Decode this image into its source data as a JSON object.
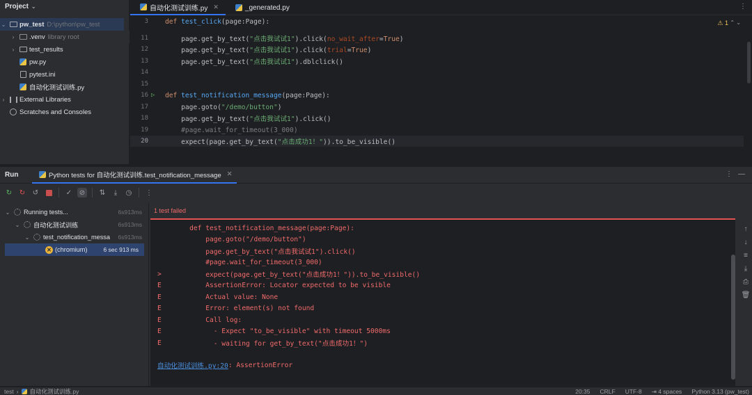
{
  "project": {
    "header": "Project",
    "tree": [
      {
        "label": "pw_test",
        "hint": "D:\\python\\pw_test",
        "type": "root"
      },
      {
        "label": ".venv",
        "hint": "library root",
        "type": "folder-dark"
      },
      {
        "label": "test_results",
        "hint": "",
        "type": "folder"
      },
      {
        "label": "pw.py",
        "hint": "",
        "type": "py"
      },
      {
        "label": "pytest.ini",
        "hint": "",
        "type": "ini"
      },
      {
        "label": "自动化测试训练.py",
        "hint": "",
        "type": "py"
      },
      {
        "label": "External Libraries",
        "hint": "",
        "type": "lib"
      },
      {
        "label": "Scratches and Consoles",
        "hint": "",
        "type": "scratch"
      }
    ]
  },
  "editor": {
    "tabs": [
      {
        "label": "自动化测试训练.py",
        "active": true
      },
      {
        "label": "_generated.py",
        "active": false
      }
    ],
    "warnings": "1",
    "lines": [
      {
        "n": "3",
        "text": "def test_click(page:Page):"
      },
      {
        "n": "11",
        "text": "    page.get_by_text(\"点击我试试1\").click(no_wait_after=True)"
      },
      {
        "n": "12",
        "text": "    page.get_by_text(\"点击我试试1\").click(trial=True)"
      },
      {
        "n": "13",
        "text": "    page.get_by_text(\"点击我试试1\").dblclick()"
      },
      {
        "n": "14",
        "text": ""
      },
      {
        "n": "15",
        "text": ""
      },
      {
        "n": "16",
        "text": "def test_notification_message(page:Page):"
      },
      {
        "n": "17",
        "text": "    page.goto(\"/demo/button\")"
      },
      {
        "n": "18",
        "text": "    page.get_by_text(\"点击我试试1\").click()"
      },
      {
        "n": "19",
        "text": "    #page.wait_for_timeout(3_000)"
      },
      {
        "n": "20",
        "text": "    expect(page.get_by_text(\"点击成功1！\")).to_be_visible()"
      }
    ]
  },
  "run": {
    "title": "Run",
    "tab_label": "Python tests for 自动化测试训练.test_notification_message",
    "tree": [
      {
        "label": "Running tests...",
        "time": "6s913ms"
      },
      {
        "label": "自动化测试训练",
        "time": "6s913ms"
      },
      {
        "label": "test_notification_messa",
        "time": "6s913ms"
      },
      {
        "label": "(chromium)",
        "time": "6 sec 913 ms"
      }
    ],
    "status": "1 test failed",
    "output": [
      {
        "mark": "",
        "text": "    def test_notification_message(page:Page):"
      },
      {
        "mark": "",
        "text": "        page.goto(\"/demo/button\")"
      },
      {
        "mark": "",
        "text": "        page.get_by_text(\"点击我试试1\").click()"
      },
      {
        "mark": "",
        "text": "        #page.wait_for_timeout(3_000)"
      },
      {
        "mark": ">",
        "text": "        expect(page.get_by_text(\"点击成功1！\")).to_be_visible()"
      },
      {
        "mark": "E",
        "text": "        AssertionError: Locator expected to be visible"
      },
      {
        "mark": "E",
        "text": "        Actual value: None"
      },
      {
        "mark": "E",
        "text": "        Error: element(s) not found"
      },
      {
        "mark": "E",
        "text": "        Call log:"
      },
      {
        "mark": "E",
        "text": "          - Expect \"to_be_visible\" with timeout 5000ms"
      },
      {
        "mark": "E",
        "text": "          - waiting for get_by_text(\"点击成功1！\")"
      },
      {
        "mark": "",
        "text": ""
      }
    ],
    "trace_link": "自动化测试训练.py:20",
    "trace_error": ": AssertionError"
  },
  "status_bar": {
    "crumbs": [
      "test",
      "自动化测试训练.py"
    ],
    "position": "20:35",
    "line_ending": "CRLF",
    "encoding": "UTF-8",
    "indent": "4 spaces",
    "interpreter": "Python 3.13 (pw_test)"
  },
  "colors": {
    "accent": "#3574f0",
    "error": "#f06b6b",
    "selection": "#2e436e"
  }
}
